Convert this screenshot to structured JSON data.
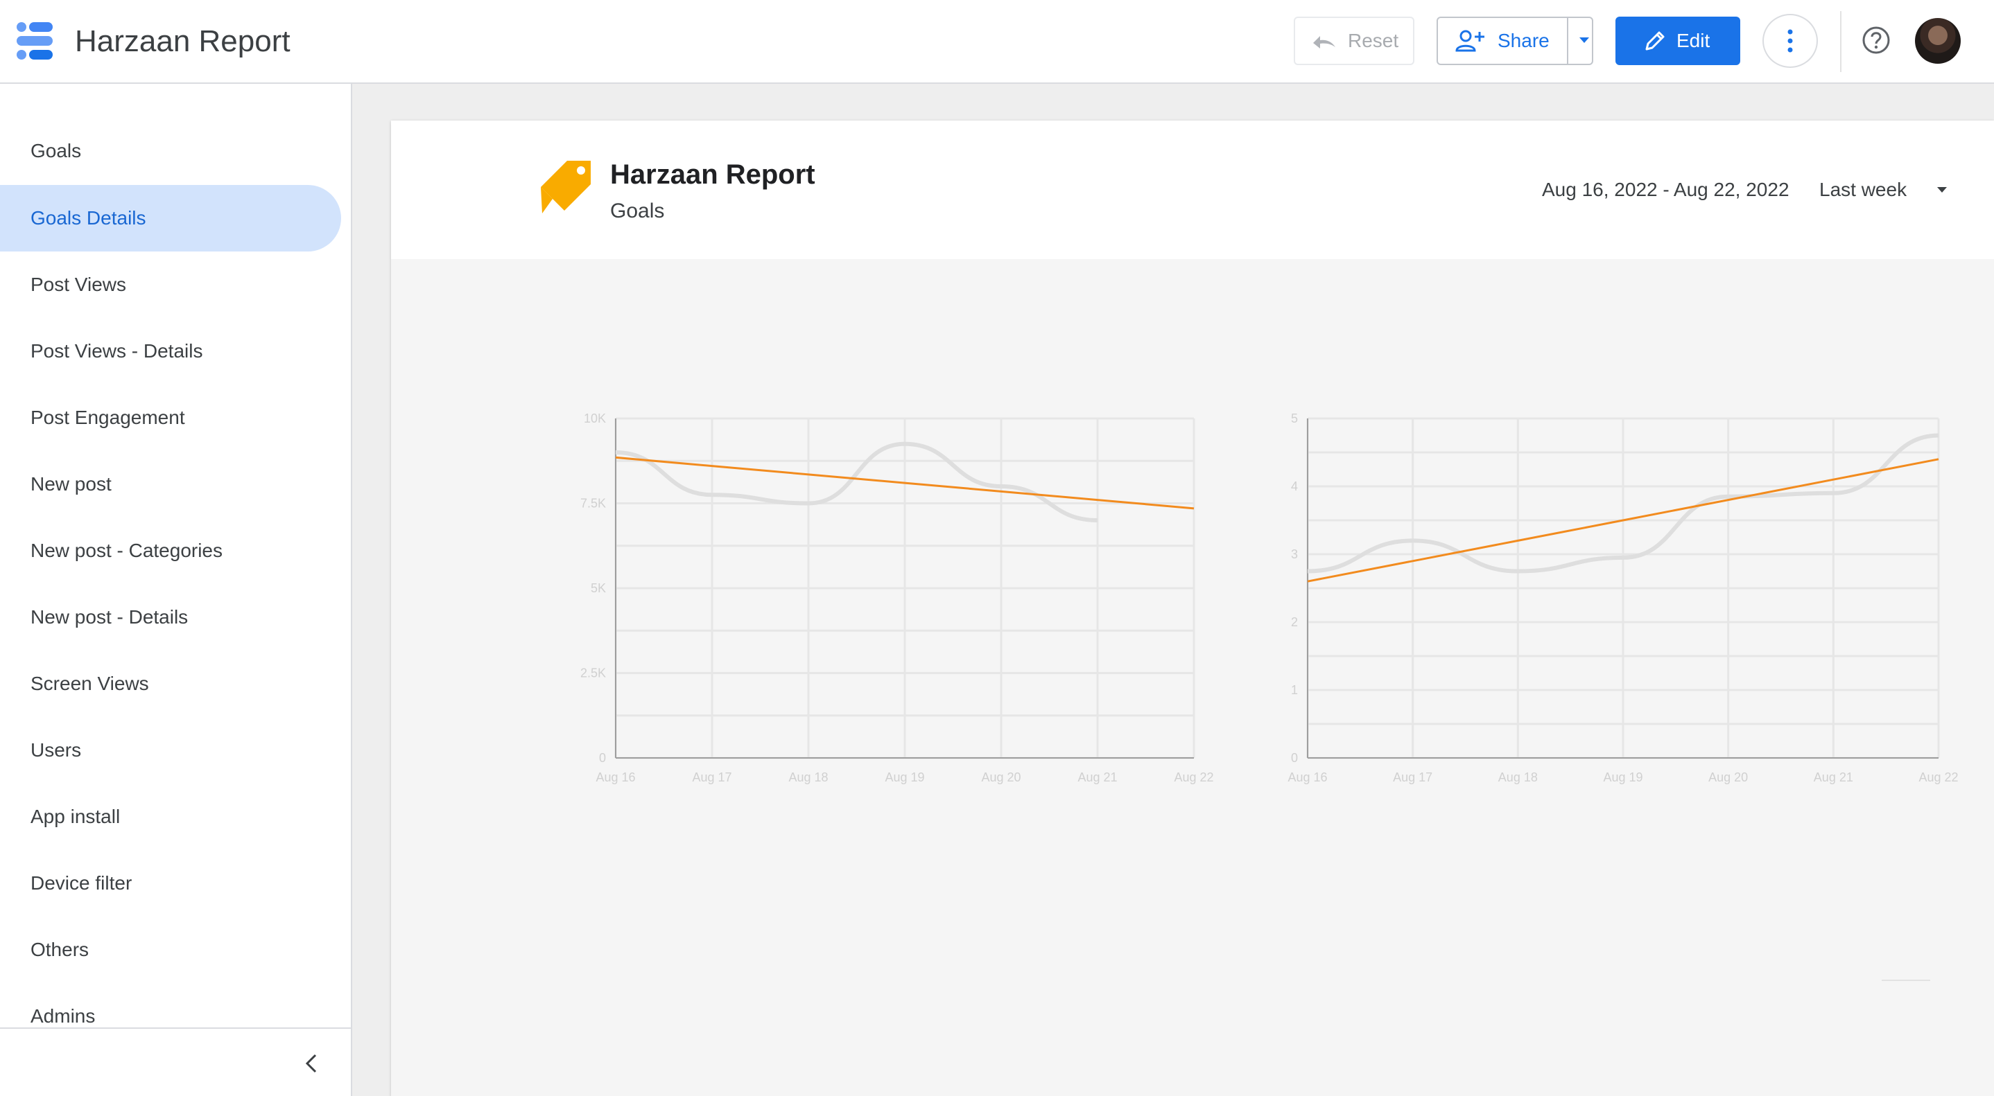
{
  "app": {
    "title": "Harzaan Report"
  },
  "toolbar": {
    "reset_label": "Reset",
    "share_label": "Share",
    "edit_label": "Edit",
    "icons": [
      "undo-icon",
      "person-add-icon",
      "caret-down-icon",
      "pencil-icon",
      "more-vert-icon",
      "help-icon"
    ]
  },
  "sidebar": {
    "items": [
      {
        "label": "Goals",
        "active": false
      },
      {
        "label": "Goals Details",
        "active": true
      },
      {
        "label": "Post Views",
        "active": false
      },
      {
        "label": "Post Views - Details",
        "active": false
      },
      {
        "label": "Post Engagement",
        "active": false
      },
      {
        "label": "New post",
        "active": false
      },
      {
        "label": "New post - Categories",
        "active": false
      },
      {
        "label": "New post - Details",
        "active": false
      },
      {
        "label": "Screen Views",
        "active": false
      },
      {
        "label": "Users",
        "active": false
      },
      {
        "label": "App install",
        "active": false
      },
      {
        "label": "Device filter",
        "active": false
      },
      {
        "label": "Others",
        "active": false
      },
      {
        "label": "Admins",
        "active": false
      }
    ]
  },
  "report": {
    "title": "Harzaan Report",
    "subtitle": "Goals",
    "date_range": "Aug 16, 2022 - Aug 22, 2022",
    "date_preset": "Last week"
  },
  "colors": {
    "accent": "#1a73e8",
    "trend": "#f28b1e",
    "active_nav_bg": "#d2e3fc",
    "logo_orange": "#f9ab00"
  },
  "chart_data": [
    {
      "type": "line",
      "categories": [
        "Aug 16",
        "Aug 17",
        "Aug 18",
        "Aug 19",
        "Aug 20",
        "Aug 21",
        "Aug 22"
      ],
      "series": [
        {
          "values": [
            9000,
            7750,
            7500,
            9250,
            8000,
            7000,
            null
          ]
        },
        {
          "values": [
            8850,
            8600,
            8350,
            8100,
            7850,
            7600,
            7350
          ]
        }
      ],
      "ylim": [
        0,
        10000
      ],
      "yticks": [
        "0",
        "2.5K",
        "5K",
        "7.5K",
        "10K"
      ],
      "grid": true
    },
    {
      "type": "line",
      "categories": [
        "Aug 16",
        "Aug 17",
        "Aug 18",
        "Aug 19",
        "Aug 20",
        "Aug 21",
        "Aug 22"
      ],
      "series": [
        {
          "values": [
            2.75,
            3.2,
            2.75,
            2.95,
            3.85,
            3.9,
            4.75
          ]
        },
        {
          "values": [
            2.6,
            2.9,
            3.2,
            3.5,
            3.8,
            4.1,
            4.4
          ]
        }
      ],
      "ylim": [
        0,
        5
      ],
      "yticks": [
        "0",
        "1",
        "2",
        "3",
        "4",
        "5"
      ],
      "grid": true
    }
  ]
}
